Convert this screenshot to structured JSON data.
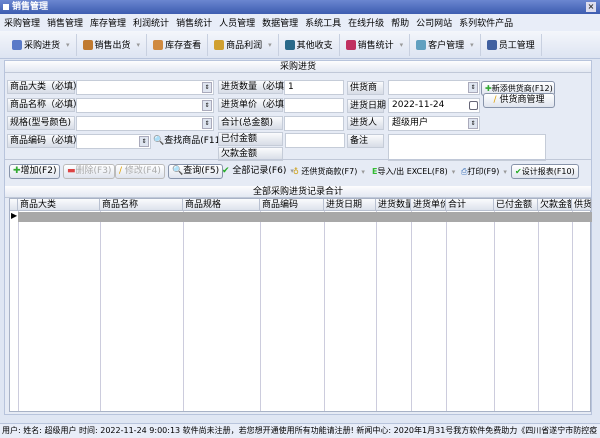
{
  "window": {
    "title": "销售管理"
  },
  "menu": [
    "采购管理",
    "销售管理",
    "库存管理",
    "利润统计",
    "销售统计",
    "人员管理",
    "数据管理",
    "系统工具",
    "在线升级",
    "帮助",
    "公司网站",
    "系列软件产品"
  ],
  "toolbar": [
    {
      "label": "采购进货",
      "icon": "purchase-icon",
      "color": "#5a7ac8",
      "dropdown": true
    },
    {
      "label": "销售出货",
      "icon": "sales-icon",
      "color": "#c07a30",
      "dropdown": true
    },
    {
      "label": "库存查看",
      "icon": "box-icon",
      "color": "#d08a40",
      "dropdown": false
    },
    {
      "label": "商品利润",
      "icon": "money-bag-icon",
      "color": "#d0a030",
      "dropdown": true
    },
    {
      "label": "其他收支",
      "icon": "ledger-icon",
      "color": "#2a6a8a",
      "dropdown": false
    },
    {
      "label": "销售统计",
      "icon": "chart-icon",
      "color": "#c03060",
      "dropdown": true
    },
    {
      "label": "客户管理",
      "icon": "customer-icon",
      "color": "#60a0c0",
      "dropdown": true
    },
    {
      "label": "员工管理",
      "icon": "staff-icon",
      "color": "#4060a0",
      "dropdown": false
    }
  ],
  "form": {
    "header": "采购进货",
    "category_label": "商品大类（必填）",
    "category_value": "",
    "name_label": "商品名称（必填）",
    "name_value": "",
    "spec_label": "规格(型号颜色)",
    "spec_value": "",
    "code_label": "商品编码（必填）",
    "code_value": "",
    "find_label": "查找商品(F11)",
    "qty_label": "进货数量（必填）",
    "qty_value": "1",
    "price_label": "进货单价（必填）",
    "price_value": "",
    "total_label": "合计(总金额)",
    "total_value": "",
    "paid_label": "已付金额",
    "paid_value": "",
    "owed_label": "欠款金额",
    "supplier_label": "供货商",
    "supplier_value": "",
    "date_label": "进货日期",
    "date_value": "2022-11-24",
    "buyer_label": "进货人",
    "buyer_value": "超级用户",
    "note_label": "备注",
    "note_value": "",
    "add_supplier": "新添供货商(F12)",
    "manage_supplier": "供货商管理"
  },
  "actions": {
    "add": "增加(F2)",
    "delete": "删除(F3)",
    "edit": "修改(F4)",
    "query": "查询(F5)",
    "all": "全部记录(F6)",
    "repay": "还供货商款(F7)",
    "excel": "导入/出 EXCEL(F8)",
    "print": "打印(F9)",
    "design": "设计报表(F10)"
  },
  "grid": {
    "title": "全部采购进货记录合计",
    "columns": [
      "商品大类",
      "商品名称",
      "商品规格",
      "商品编码",
      "进货日期",
      "进货数量",
      "进货单价",
      "合计",
      "已付金额",
      "欠款金额",
      "供货商"
    ]
  },
  "status": "用户:  姓名: 超级用户  时间: 2022-11-24 9:00:13 软件尚未注册，若您想开通使用所有功能请注册! 新闻中心: 2020年1月31号我方软件免费助力《四川省遂宁市防控疫"
}
